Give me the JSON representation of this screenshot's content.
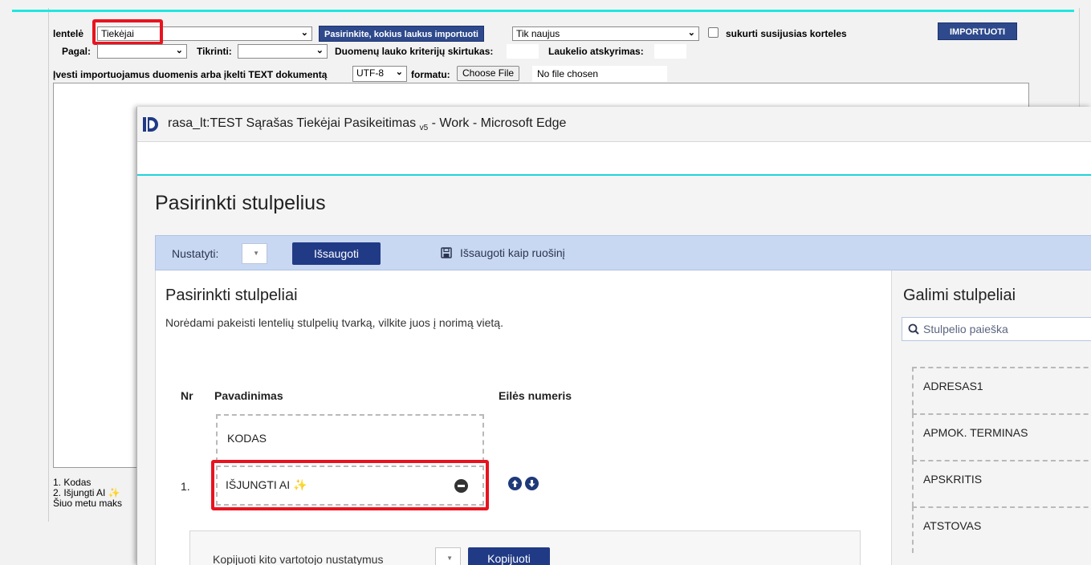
{
  "background": {
    "table_label": "lentelė",
    "table_value": "Tiekėjai",
    "choose_fields_button": "Pasirinkite,  kokius laukus importuoti",
    "mode_value": "Tik naujus",
    "create_related_label": "sukurti susijusias korteles",
    "import_button": "IMPORTUOTI",
    "by_label": "Pagal:",
    "check_label": "Tikrinti:",
    "criteria_separator_label": "Duomenų lauko kriterijų skirtukas:",
    "field_separator_label": "Laukelio atskyrimas:",
    "enter_data_label": "Įvesti importuojamus duomenis arba įkelti TEXT dokumentą",
    "encoding_value": "UTF-8",
    "format_label": "formatu:",
    "choose_file_button": "Choose File",
    "no_file_text": "No file chosen",
    "bottom_list": [
      "1. Kodas",
      "2. Išjungti AI",
      "Šiuo metu maks"
    ]
  },
  "popup": {
    "title_main": "rasa_lt:TEST Sąrašas Tiekėjai Pasikeitimas",
    "title_sub": "v5",
    "title_suffix": " - Work - Microsoft Edge",
    "dialog_title": "Pasirinkti stulpelius",
    "toolbar": {
      "set_label": "Nustatyti:",
      "save_button": "Išsaugoti",
      "save_template": "Išsaugoti kaip ruošinį"
    },
    "selected": {
      "heading": "Pasirinkti stulpeliai",
      "instructions": "Norėdami pakeisti lentelių stulpelių tvarką, vilkite juos į norimą vietą.",
      "col_nr": "Nr",
      "col_name": "Pavadinimas",
      "col_order": "Eilės numeris",
      "fixed_row": "KODAS",
      "rows": [
        {
          "nr": "1.",
          "name": "IŠJUNGTI AI"
        }
      ]
    },
    "copy": {
      "label": "Kopijuoti kito vartotojo nustatymus",
      "button": "Kopijuoti"
    },
    "available": {
      "heading": "Galimi stulpeliai",
      "search_placeholder": "Stulpelio paieška",
      "items": [
        "ADRESAS1",
        "APMOK. TERMINAS",
        "APSKRITIS",
        "ATSTOVAS"
      ]
    }
  },
  "colors": {
    "accent_navy": "#213a86",
    "highlight_red": "#e8131f",
    "cyan_line": "#21e6e0",
    "toolbar_blue": "#c9d8f2"
  }
}
